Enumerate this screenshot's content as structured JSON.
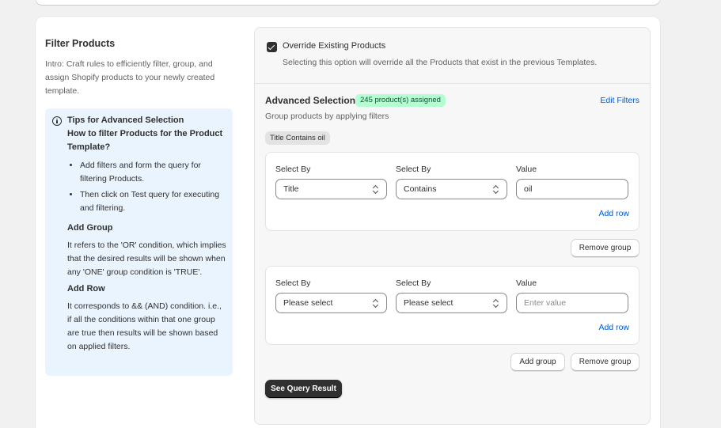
{
  "section": {
    "title": "Filter Products",
    "intro": "Intro: Craft rules to efficiently filter, group, and assign Shopify products to your newly created template."
  },
  "tips": {
    "icon": "info-icon",
    "title": "Tips for Advanced Selection",
    "subtitle": "How to filter Products for the Product Template?",
    "bullets": [
      "Add filters and form the query for filtering Products.",
      "Then click on Test query for executing and filtering."
    ],
    "add_group_heading": "Add Group",
    "add_group_text": "It refers to the 'OR' condition, which implies that the desired results will be shown when any 'ONE' group condition is 'TRUE'.",
    "add_row_heading": "Add Row",
    "add_row_text": "It corresponds to && (AND) condition. i.e., if all the conditions within that one group are true then results will be shown based on applied filters."
  },
  "override": {
    "checked": true,
    "label": "Override Existing Products",
    "help": "Selecting this option will override all the Products that exist in the previous Templates."
  },
  "advanced": {
    "title": "Advanced Selection",
    "badge": "245 product(s) assigned",
    "badge_color": "#b4fed2",
    "edit_filters": "Edit Filters",
    "subtitle": "Group products by applying filters",
    "tag": "Title Contains oil"
  },
  "groups": [
    {
      "label_select1": "Select By",
      "label_select2": "Select By",
      "label_value": "Value",
      "select1": "Title",
      "select2": "Contains",
      "value": "oil",
      "value_placeholder": "",
      "add_row": "Add row"
    },
    {
      "label_select1": "Select By",
      "label_select2": "Select By",
      "label_value": "Value",
      "select1": "Please select",
      "select2": "Please select",
      "value": "",
      "value_placeholder": "Enter value",
      "add_row": "Add row"
    }
  ],
  "buttons": {
    "remove_group": "Remove group",
    "add_group": "Add group",
    "see_query": "See Query Result"
  }
}
